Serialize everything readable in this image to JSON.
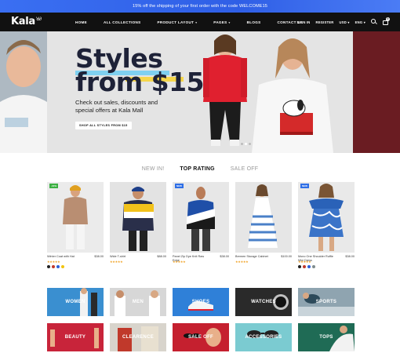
{
  "announcement": "15% off the shipping of your first order with the code WELCOME15",
  "brand": {
    "logo": "Kala",
    "mark": "ꓤ∂"
  },
  "nav": [
    {
      "label": "HOME",
      "dropdown": false
    },
    {
      "label": "ALL COLLECTIONS",
      "dropdown": false
    },
    {
      "label": "PRODUCT LAYOUT",
      "dropdown": true
    },
    {
      "label": "PAGES",
      "dropdown": true
    },
    {
      "label": "BLOGS",
      "dropdown": false
    },
    {
      "label": "CONTACT US",
      "dropdown": false
    }
  ],
  "header_right": {
    "signin": "SIGN IN",
    "register": "REGISTER",
    "currency": "USD",
    "language": "ENG",
    "cart_count": "0"
  },
  "hero": {
    "title_line1": "Styles",
    "title_line2": "from $15",
    "subtitle": "Check out sales, discounts and special offers at Kala Mall",
    "button": "SHOP ALL STYLES FROM $15",
    "active_slide": 2,
    "slide_count": 3
  },
  "tabs": [
    {
      "label": "NEW IN!",
      "active": false
    },
    {
      "label": "TOP RATING",
      "active": true
    },
    {
      "label": "SALE OFF",
      "active": false
    }
  ],
  "products": [
    {
      "name": "Winter Coat with Hat",
      "price": "$38.00",
      "stars": 5,
      "tag": "-10%",
      "tag_color": "#3cb043",
      "swatches": [
        "#222222",
        "#c0392b",
        "#2e5fd6",
        "#f1c40f"
      ],
      "bg": "#e9e9e9"
    },
    {
      "name": "Wide T-shirt",
      "price": "$88.00",
      "stars": 5,
      "tag": "",
      "tag_color": "",
      "swatches": [],
      "bg": "#e2e2e2"
    },
    {
      "name": "Panel Zip Dye Knit Raw Edge",
      "price": "$38.00",
      "stars": 5,
      "tag": "NEW",
      "tag_color": "#2f6fe6",
      "swatches": [],
      "bg": "#e6e6e6"
    },
    {
      "name": "Bremen Storage Cabinet",
      "price": "$100.00",
      "stars": 5,
      "tag": "",
      "tag_color": "",
      "swatches": [],
      "bg": "#e5e5e5"
    },
    {
      "name": "Mono One Shoulder Ruffle Mini Dress",
      "price": "$38.00",
      "stars": 5,
      "tag": "NEW",
      "tag_color": "#2f6fe6",
      "swatches": [
        "#222222",
        "#c0392b",
        "#2e5fd6",
        "#7f8c8d"
      ],
      "bg": "#e8e8e8"
    }
  ],
  "categories": [
    {
      "label": "WOMEN",
      "bg": "#3a8fd0"
    },
    {
      "label": "MEN",
      "bg": "#d7d7d7"
    },
    {
      "label": "SHOES",
      "bg": "#2f80d8"
    },
    {
      "label": "WATCHES",
      "bg": "#2a2a2a"
    },
    {
      "label": "SPORTS",
      "bg": "#8fa4b0"
    },
    {
      "label": "BEAUTY",
      "bg": "#c8243a"
    },
    {
      "label": "CLEARENCE",
      "bg": "#d8d4cc"
    },
    {
      "label": "SALE OFF",
      "bg": "#c5202f"
    },
    {
      "label": "ACCESSORIES",
      "bg": "#7bcbd1"
    },
    {
      "label": "TOPS",
      "bg": "#1f6b55"
    }
  ]
}
